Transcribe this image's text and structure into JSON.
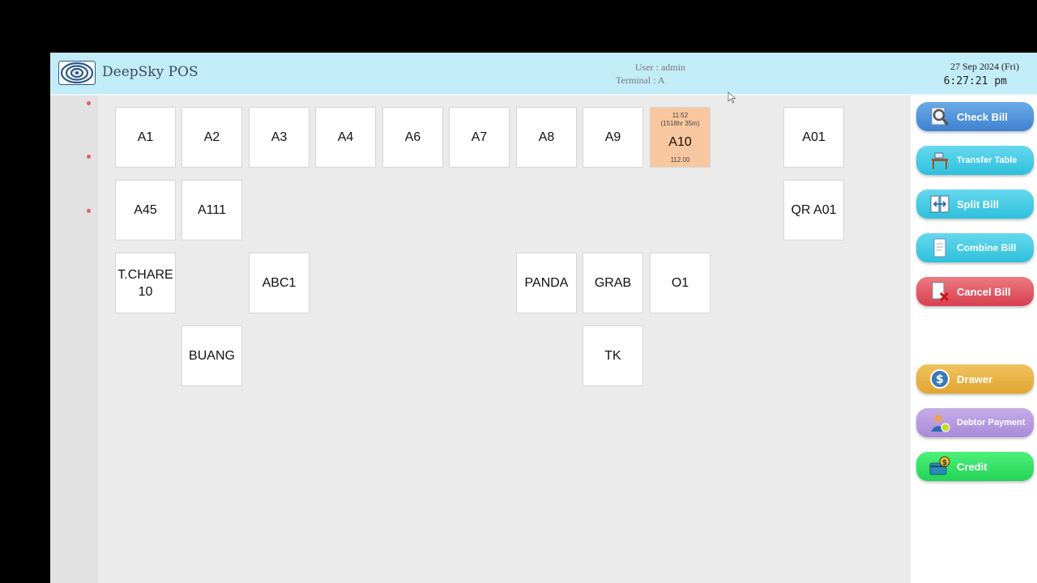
{
  "header": {
    "app_title": "DeepSky POS",
    "user": "User : admin",
    "terminal": "Terminal : A",
    "date": "27 Sep 2024 (Fri)",
    "time": "6:27:21 pm"
  },
  "tables": {
    "a1": "A1",
    "a2": "A2",
    "a3": "A3",
    "a4": "A4",
    "a6": "A6",
    "a7": "A7",
    "a8": "A8",
    "a9": "A9",
    "a10": {
      "name": "A10",
      "time": "11:52",
      "duration": "(1518hr 35m)",
      "amount": "112.00"
    },
    "a01": "A01",
    "a45": "A45",
    "a111": "A111",
    "qr_a01": "QR A01",
    "tchare_line1": "T.CHARE",
    "tchare_line2": "10",
    "abc1": "ABC1",
    "panda": "PANDA",
    "grab": "GRAB",
    "o1": "O1",
    "buang": "BUANG",
    "tk": "TK"
  },
  "actions": {
    "check_bill": "Check Bill",
    "transfer_table": "Transfer Table",
    "split_bill": "Split Bill",
    "combine_bill": "Combine Bill",
    "cancel_bill": "Cancel Bill",
    "drawer": "Drawer",
    "debtor_payment": "Debtor Payment",
    "credit": "Credit"
  },
  "colors": {
    "header_bg": "#c2ecf8",
    "occupied_table": "#f8c79f",
    "check_bill": "#4a90d9",
    "teal_buttons": "#3cc8e0",
    "cancel_bill": "#e05560",
    "drawer": "#e8b040",
    "debtor_payment": "#b89ce0",
    "credit": "#2ee060"
  }
}
